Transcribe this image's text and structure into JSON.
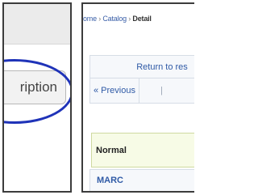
{
  "left_panel": {
    "button_label": "ription",
    "highlight_color": "#1f33b8"
  },
  "right_panel": {
    "breadcrumb": {
      "home": "ome",
      "catalog": "Catalog",
      "current": "Detail",
      "separator": "›"
    },
    "nav": {
      "return_label": "Return to res",
      "previous_label": "« Previous",
      "divider": "|"
    },
    "view_modes": {
      "normal_label": "Normal",
      "marc_label": "MARC"
    }
  }
}
